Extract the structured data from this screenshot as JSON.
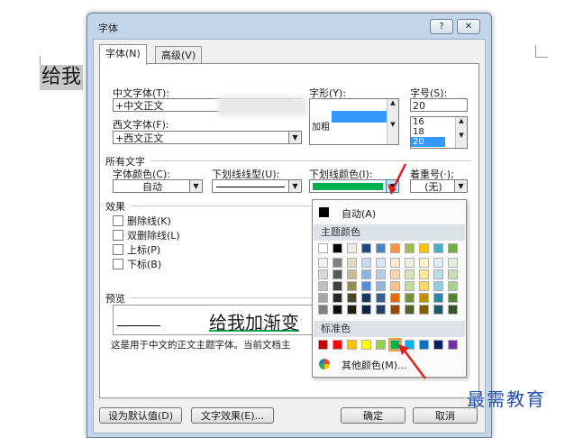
{
  "document": {
    "text": "给我"
  },
  "dialog": {
    "title": "字体",
    "help_btn": "?",
    "close_btn": "✕",
    "tabs": [
      {
        "label": "字体(N)"
      },
      {
        "label": "高级(V)"
      }
    ],
    "chinese_font": {
      "label": "中文字体(T):",
      "value": "+中文正文"
    },
    "western_font": {
      "label": "西文字体(F):",
      "value": "+西文正文"
    },
    "style": {
      "label": "字形(Y):",
      "items": [
        "",
        "",
        "加粗"
      ]
    },
    "size": {
      "label": "字号(S):",
      "value": "20",
      "items": [
        "16",
        "18",
        "20"
      ]
    },
    "all_text": {
      "label": "所有文字"
    },
    "font_color": {
      "label": "字体颜色(C):",
      "value": "自动"
    },
    "underline_style": {
      "label": "下划线线型(U):"
    },
    "underline_color": {
      "label": "下划线颜色(I):"
    },
    "emphasis": {
      "label": "着重号(·);",
      "value": "(无)"
    },
    "effects": {
      "label": "效果",
      "items": [
        {
          "label": "删除线(K)"
        },
        {
          "label": "双删除线(L)"
        },
        {
          "label": "上标(P)"
        },
        {
          "label": "下标(B)"
        }
      ]
    },
    "preview": {
      "label": "预览",
      "sample": "给我加渐变",
      "description": "这是用于中文的正文主题字体。当前文档主"
    },
    "buttons": {
      "set_default": "设为默认值(D)",
      "text_effects": "文字效果(E)...",
      "ok": "确定",
      "cancel": "取消"
    }
  },
  "color_popup": {
    "auto_label": "自动(A)",
    "theme_label": "主题颜色",
    "standard_label": "标准色",
    "more_label": "其他颜色(M)...",
    "theme_colors": [
      "#ffffff",
      "#000000",
      "#eeece1",
      "#1f497d",
      "#4f81bd",
      "#f79646",
      "#9bbb59",
      "#ffc000",
      "#4bacc6",
      "#70ad47"
    ],
    "theme_shades": [
      [
        "#f2f2f2",
        "#808080",
        "#ddd9c3",
        "#c6d9f1",
        "#dbe5f1",
        "#fde9d9",
        "#ebf1de",
        "#fff2cc",
        "#daeef3",
        "#e2efd9"
      ],
      [
        "#d9d9d9",
        "#595959",
        "#c4bd97",
        "#8eb4e3",
        "#b8cce4",
        "#fbd5b5",
        "#d7e3bc",
        "#ffe699",
        "#b7dde8",
        "#c5e0b3"
      ],
      [
        "#bfbfbf",
        "#404040",
        "#948a54",
        "#558ed5",
        "#95b3d7",
        "#fac08f",
        "#c3d69b",
        "#ffd966",
        "#93cddd",
        "#a8d08d"
      ],
      [
        "#a6a6a6",
        "#262626",
        "#4a452a",
        "#17375e",
        "#366092",
        "#e46c0a",
        "#76923c",
        "#bf9000",
        "#31859c",
        "#538135"
      ],
      [
        "#7f7f7f",
        "#0d0d0d",
        "#1e1c11",
        "#0f243e",
        "#244062",
        "#974806",
        "#4f6228",
        "#7f6000",
        "#215968",
        "#375623"
      ]
    ],
    "standard_colors": [
      "#c00000",
      "#ff0000",
      "#ffc000",
      "#ffff00",
      "#92d050",
      "#00b050",
      "#00b0f0",
      "#0070c0",
      "#002060",
      "#7030a0"
    ],
    "selected_underline_color": "#00b050"
  },
  "watermark": {
    "text": "最需教育"
  }
}
